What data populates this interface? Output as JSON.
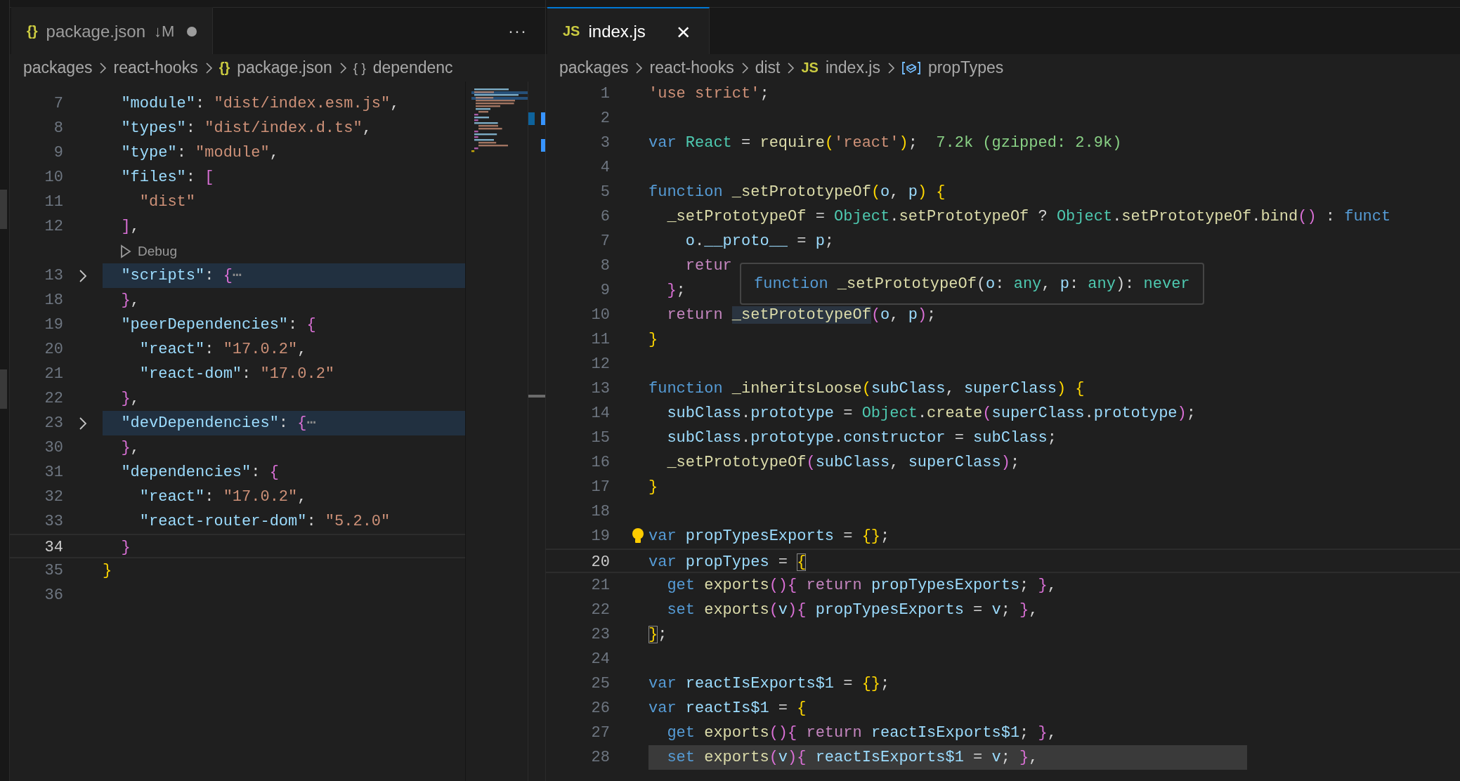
{
  "left_group": {
    "focused": false,
    "tabs": [
      {
        "icon": "{}",
        "label": "package.json",
        "badge": "↓M",
        "modified": true,
        "selected": true
      }
    ],
    "more": "···",
    "breadcrumbs": [
      {
        "kind": "text",
        "label": "packages"
      },
      {
        "kind": "text",
        "label": "react-hooks"
      },
      {
        "kind": "glyph",
        "icon": "{}",
        "label": "package.json"
      },
      {
        "kind": "glyph",
        "icon": "{ }",
        "label": "dependenc"
      }
    ],
    "lines": [
      {
        "kind": "code",
        "number": "7",
        "tokens": [
          {
            "kind": "key",
            "text": "  \"module\""
          },
          {
            "kind": "t",
            "text": ": "
          },
          {
            "kind": "str",
            "text": "\"dist/index.esm.js\""
          },
          {
            "kind": "t",
            "text": ","
          }
        ]
      },
      {
        "kind": "code",
        "number": "8",
        "tokens": [
          {
            "kind": "key",
            "text": "  \"types\""
          },
          {
            "kind": "t",
            "text": ": "
          },
          {
            "kind": "str",
            "text": "\"dist/index.d.ts\""
          },
          {
            "kind": "t",
            "text": ","
          }
        ]
      },
      {
        "kind": "code",
        "number": "9",
        "tokens": [
          {
            "kind": "key",
            "text": "  \"type\""
          },
          {
            "kind": "t",
            "text": ": "
          },
          {
            "kind": "str",
            "text": "\"module\""
          },
          {
            "kind": "t",
            "text": ","
          }
        ]
      },
      {
        "kind": "code",
        "number": "10",
        "tokens": [
          {
            "kind": "key",
            "text": "  \"files\""
          },
          {
            "kind": "t",
            "text": ": "
          },
          {
            "kind": "b2",
            "text": "["
          }
        ]
      },
      {
        "kind": "code",
        "number": "11",
        "tokens": [
          {
            "kind": "str",
            "text": "    \"dist\""
          }
        ]
      },
      {
        "kind": "code",
        "number": "12",
        "tokens": [
          {
            "kind": "b2",
            "text": "  ]"
          },
          {
            "kind": "t",
            "text": ","
          }
        ]
      },
      {
        "kind": "codelens",
        "label": "Debug"
      },
      {
        "kind": "folded",
        "number": "13",
        "tokens": [
          {
            "kind": "key",
            "text": "  \"scripts\""
          },
          {
            "kind": "t",
            "text": ": "
          },
          {
            "kind": "b2",
            "text": "{"
          },
          {
            "kind": "more",
            "text": "⋯"
          }
        ]
      },
      {
        "kind": "code",
        "number": "18",
        "tokens": [
          {
            "kind": "b2",
            "text": "  }"
          },
          {
            "kind": "t",
            "text": ","
          }
        ]
      },
      {
        "kind": "code",
        "number": "19",
        "tokens": [
          {
            "kind": "key",
            "text": "  \"peerDependencies\""
          },
          {
            "kind": "t",
            "text": ": "
          },
          {
            "kind": "b2",
            "text": "{"
          }
        ]
      },
      {
        "kind": "code",
        "number": "20",
        "tokens": [
          {
            "kind": "key",
            "text": "    \"react\""
          },
          {
            "kind": "t",
            "text": ": "
          },
          {
            "kind": "str",
            "text": "\"17.0.2\""
          },
          {
            "kind": "t",
            "text": ","
          }
        ]
      },
      {
        "kind": "code",
        "number": "21",
        "tokens": [
          {
            "kind": "key",
            "text": "    \"react-dom\""
          },
          {
            "kind": "t",
            "text": ": "
          },
          {
            "kind": "str",
            "text": "\"17.0.2\""
          }
        ]
      },
      {
        "kind": "code",
        "number": "22",
        "tokens": [
          {
            "kind": "b2",
            "text": "  }"
          },
          {
            "kind": "t",
            "text": ","
          }
        ]
      },
      {
        "kind": "folded",
        "number": "23",
        "tokens": [
          {
            "kind": "key",
            "text": "  \"devDependencies\""
          },
          {
            "kind": "t",
            "text": ": "
          },
          {
            "kind": "b2",
            "text": "{"
          },
          {
            "kind": "more",
            "text": "⋯"
          }
        ]
      },
      {
        "kind": "code",
        "number": "30",
        "tokens": [
          {
            "kind": "b2",
            "text": "  }"
          },
          {
            "kind": "t",
            "text": ","
          }
        ]
      },
      {
        "kind": "code",
        "number": "31",
        "tokens": [
          {
            "kind": "key",
            "text": "  \"dependencies\""
          },
          {
            "kind": "t",
            "text": ": "
          },
          {
            "kind": "b2",
            "text": "{"
          }
        ]
      },
      {
        "kind": "code",
        "number": "32",
        "tokens": [
          {
            "kind": "key",
            "text": "    \"react\""
          },
          {
            "kind": "t",
            "text": ": "
          },
          {
            "kind": "str",
            "text": "\"17.0.2\""
          },
          {
            "kind": "t",
            "text": ","
          }
        ]
      },
      {
        "kind": "code",
        "number": "33",
        "tokens": [
          {
            "kind": "key",
            "text": "    \"react-router-dom\""
          },
          {
            "kind": "t",
            "text": ": "
          },
          {
            "kind": "str",
            "text": "\"5.2.0\""
          }
        ]
      },
      {
        "kind": "current",
        "number": "34",
        "tokens": [
          {
            "kind": "b2",
            "text": "  }"
          }
        ]
      },
      {
        "kind": "code",
        "number": "35",
        "tokens": [
          {
            "kind": "b1",
            "text": "}"
          }
        ]
      },
      {
        "kind": "code",
        "number": "36"
      }
    ]
  },
  "right_group": {
    "focused": true,
    "tabs": [
      {
        "icon": "JS",
        "label": "index.js",
        "close": "×",
        "modified": false,
        "selected": true
      }
    ],
    "breadcrumbs": [
      {
        "kind": "text",
        "label": "packages"
      },
      {
        "kind": "text",
        "label": "react-hooks"
      },
      {
        "kind": "text",
        "label": "dist"
      },
      {
        "kind": "glyph",
        "icon": "JS",
        "label": "index.js"
      },
      {
        "kind": "symbol",
        "label": "propTypes"
      }
    ],
    "lines": [
      {
        "kind": "code",
        "number": "1",
        "tokens": [
          {
            "kind": "str",
            "text": "'use strict'"
          },
          {
            "kind": "t",
            "text": ";"
          }
        ]
      },
      {
        "kind": "code",
        "number": "2"
      },
      {
        "kind": "code",
        "number": "3",
        "tokens": [
          {
            "kind": "kw",
            "text": "var "
          },
          {
            "kind": "type",
            "text": "React"
          },
          {
            "kind": "t",
            "text": " = "
          },
          {
            "kind": "fn",
            "text": "require"
          },
          {
            "kind": "b1",
            "text": "("
          },
          {
            "kind": "str",
            "text": "'react'"
          },
          {
            "kind": "b1",
            "text": ")"
          },
          {
            "kind": "t",
            "text": ";"
          },
          {
            "kind": "hint",
            "text": "  7.2k (gzipped: 2.9k)"
          }
        ]
      },
      {
        "kind": "code",
        "number": "4"
      },
      {
        "kind": "code",
        "number": "5",
        "tokens": [
          {
            "kind": "kw",
            "text": "function "
          },
          {
            "kind": "fn",
            "text": "_setPrototypeOf"
          },
          {
            "kind": "b1",
            "text": "("
          },
          {
            "kind": "var",
            "text": "o"
          },
          {
            "kind": "t",
            "text": ", "
          },
          {
            "kind": "var",
            "text": "p"
          },
          {
            "kind": "b1",
            "text": ")"
          },
          {
            "kind": "b1",
            "text": " {"
          }
        ]
      },
      {
        "kind": "code",
        "number": "6",
        "tokens": [
          {
            "kind": "fn",
            "text": "  _setPrototypeOf"
          },
          {
            "kind": "t",
            "text": " = "
          },
          {
            "kind": "type",
            "text": "Object"
          },
          {
            "kind": "t",
            "text": "."
          },
          {
            "kind": "fn",
            "text": "setPrototypeOf"
          },
          {
            "kind": "t",
            "text": " ? "
          },
          {
            "kind": "type",
            "text": "Object"
          },
          {
            "kind": "t",
            "text": "."
          },
          {
            "kind": "fn",
            "text": "setPrototypeOf"
          },
          {
            "kind": "t",
            "text": "."
          },
          {
            "kind": "fn",
            "text": "bind"
          },
          {
            "kind": "b2",
            "text": "()"
          },
          {
            "kind": "t",
            "text": " : "
          },
          {
            "kind": "kw",
            "text": "funct"
          }
        ]
      },
      {
        "kind": "code",
        "number": "7",
        "tokens": [
          {
            "kind": "var",
            "text": "    o"
          },
          {
            "kind": "t",
            "text": "."
          },
          {
            "kind": "var",
            "text": "__proto__"
          },
          {
            "kind": "t",
            "text": " = "
          },
          {
            "kind": "var",
            "text": "p"
          },
          {
            "kind": "t",
            "text": ";"
          }
        ]
      },
      {
        "kind": "code",
        "number": "8",
        "tokens": [
          {
            "kind": "ctl",
            "text": "    retur"
          }
        ]
      },
      {
        "kind": "code",
        "number": "9",
        "tokens": [
          {
            "kind": "b2",
            "text": "  }"
          },
          {
            "kind": "t",
            "text": ";"
          }
        ]
      },
      {
        "kind": "code",
        "number": "10",
        "tokens": [
          {
            "kind": "ctl",
            "text": "  return "
          },
          {
            "kind": "fn-hover",
            "text": "_setPrototypeOf"
          },
          {
            "kind": "b2",
            "text": "("
          },
          {
            "kind": "var",
            "text": "o"
          },
          {
            "kind": "t",
            "text": ", "
          },
          {
            "kind": "var",
            "text": "p"
          },
          {
            "kind": "b2",
            "text": ")"
          },
          {
            "kind": "t",
            "text": ";"
          }
        ]
      },
      {
        "kind": "code",
        "number": "11",
        "tokens": [
          {
            "kind": "b1",
            "text": "}"
          }
        ]
      },
      {
        "kind": "code",
        "number": "12"
      },
      {
        "kind": "code",
        "number": "13",
        "tokens": [
          {
            "kind": "kw",
            "text": "function "
          },
          {
            "kind": "fn",
            "text": "_inheritsLoose"
          },
          {
            "kind": "b1",
            "text": "("
          },
          {
            "kind": "var",
            "text": "subClass"
          },
          {
            "kind": "t",
            "text": ", "
          },
          {
            "kind": "var",
            "text": "superClass"
          },
          {
            "kind": "b1",
            "text": ")"
          },
          {
            "kind": "b1",
            "text": " {"
          }
        ]
      },
      {
        "kind": "code",
        "number": "14",
        "tokens": [
          {
            "kind": "var",
            "text": "  subClass"
          },
          {
            "kind": "t",
            "text": "."
          },
          {
            "kind": "var",
            "text": "prototype"
          },
          {
            "kind": "t",
            "text": " = "
          },
          {
            "kind": "type",
            "text": "Object"
          },
          {
            "kind": "t",
            "text": "."
          },
          {
            "kind": "fn",
            "text": "create"
          },
          {
            "kind": "b2",
            "text": "("
          },
          {
            "kind": "var",
            "text": "superClass"
          },
          {
            "kind": "t",
            "text": "."
          },
          {
            "kind": "var",
            "text": "prototype"
          },
          {
            "kind": "b2",
            "text": ")"
          },
          {
            "kind": "t",
            "text": ";"
          }
        ]
      },
      {
        "kind": "code",
        "number": "15",
        "tokens": [
          {
            "kind": "var",
            "text": "  subClass"
          },
          {
            "kind": "t",
            "text": "."
          },
          {
            "kind": "var",
            "text": "prototype"
          },
          {
            "kind": "t",
            "text": "."
          },
          {
            "kind": "var",
            "text": "constructor"
          },
          {
            "kind": "t",
            "text": " = "
          },
          {
            "kind": "var",
            "text": "subClass"
          },
          {
            "kind": "t",
            "text": ";"
          }
        ]
      },
      {
        "kind": "code",
        "number": "16",
        "tokens": [
          {
            "kind": "fn",
            "text": "  _setPrototypeOf"
          },
          {
            "kind": "b2",
            "text": "("
          },
          {
            "kind": "var",
            "text": "subClass"
          },
          {
            "kind": "t",
            "text": ", "
          },
          {
            "kind": "var",
            "text": "superClass"
          },
          {
            "kind": "b2",
            "text": ")"
          },
          {
            "kind": "t",
            "text": ";"
          }
        ]
      },
      {
        "kind": "code",
        "number": "17",
        "tokens": [
          {
            "kind": "b1",
            "text": "}"
          }
        ]
      },
      {
        "kind": "code",
        "number": "18"
      },
      {
        "kind": "lightbulb",
        "number": "19",
        "tokens": [
          {
            "kind": "kw",
            "text": "var "
          },
          {
            "kind": "var",
            "text": "propTypesExports"
          },
          {
            "kind": "t",
            "text": " = "
          },
          {
            "kind": "b1",
            "text": "{}"
          },
          {
            "kind": "t",
            "text": ";"
          }
        ]
      },
      {
        "kind": "current",
        "number": "20",
        "tokens": [
          {
            "kind": "kw",
            "text": "var "
          },
          {
            "kind": "var",
            "text": "propTypes"
          },
          {
            "kind": "t",
            "text": " = "
          },
          {
            "kind": "b1-match",
            "text": "{"
          }
        ]
      },
      {
        "kind": "code",
        "number": "21",
        "tokens": [
          {
            "kind": "kw",
            "text": "  get "
          },
          {
            "kind": "fn",
            "text": "exports"
          },
          {
            "kind": "b2",
            "text": "()"
          },
          {
            "kind": "b2",
            "text": "{"
          },
          {
            "kind": "ctl",
            "text": " return "
          },
          {
            "kind": "var",
            "text": "propTypesExports"
          },
          {
            "kind": "t",
            "text": "; "
          },
          {
            "kind": "b2",
            "text": "}"
          },
          {
            "kind": "t",
            "text": ","
          }
        ]
      },
      {
        "kind": "code",
        "number": "22",
        "tokens": [
          {
            "kind": "kw",
            "text": "  set "
          },
          {
            "kind": "fn",
            "text": "exports"
          },
          {
            "kind": "b2",
            "text": "("
          },
          {
            "kind": "var",
            "text": "v"
          },
          {
            "kind": "b2",
            "text": ")"
          },
          {
            "kind": "b2",
            "text": "{"
          },
          {
            "kind": "var",
            "text": " propTypesExports"
          },
          {
            "kind": "t",
            "text": " = "
          },
          {
            "kind": "var",
            "text": "v"
          },
          {
            "kind": "t",
            "text": "; "
          },
          {
            "kind": "b2",
            "text": "}"
          },
          {
            "kind": "t",
            "text": ","
          }
        ]
      },
      {
        "kind": "code",
        "number": "23",
        "tokens": [
          {
            "kind": "b1-match",
            "text": "}"
          },
          {
            "kind": "t",
            "text": ";"
          }
        ]
      },
      {
        "kind": "code",
        "number": "24"
      },
      {
        "kind": "code",
        "number": "25",
        "tokens": [
          {
            "kind": "kw",
            "text": "var "
          },
          {
            "kind": "var",
            "text": "reactIsExports$1"
          },
          {
            "kind": "t",
            "text": " = "
          },
          {
            "kind": "b1",
            "text": "{}"
          },
          {
            "kind": "t",
            "text": ";"
          }
        ]
      },
      {
        "kind": "code",
        "number": "26",
        "tokens": [
          {
            "kind": "kw",
            "text": "var "
          },
          {
            "kind": "var",
            "text": "reactIs$1"
          },
          {
            "kind": "t",
            "text": " = "
          },
          {
            "kind": "b1",
            "text": "{"
          }
        ]
      },
      {
        "kind": "code",
        "number": "27",
        "tokens": [
          {
            "kind": "kw",
            "text": "  get "
          },
          {
            "kind": "fn",
            "text": "exports"
          },
          {
            "kind": "b2",
            "text": "()"
          },
          {
            "kind": "b2",
            "text": "{"
          },
          {
            "kind": "ctl",
            "text": " return "
          },
          {
            "kind": "var",
            "text": "reactIsExports$1"
          },
          {
            "kind": "t",
            "text": "; "
          },
          {
            "kind": "b2",
            "text": "}"
          },
          {
            "kind": "t",
            "text": ","
          }
        ]
      },
      {
        "kind": "selection",
        "number": "28",
        "tokens": [
          {
            "kind": "kw",
            "text": "  set "
          },
          {
            "kind": "fn",
            "text": "exports"
          },
          {
            "kind": "b2",
            "text": "("
          },
          {
            "kind": "var",
            "text": "v"
          },
          {
            "kind": "b2",
            "text": ")"
          },
          {
            "kind": "b2",
            "text": "{"
          },
          {
            "kind": "var",
            "text": " reactIsExports$1"
          },
          {
            "kind": "t",
            "text": " = "
          },
          {
            "kind": "var",
            "text": "v"
          },
          {
            "kind": "t",
            "text": "; "
          },
          {
            "kind": "b2",
            "text": "}"
          },
          {
            "kind": "t",
            "text": ","
          }
        ]
      }
    ],
    "hover": {
      "tokens": [
        {
          "kind": "kw",
          "text": "function "
        },
        {
          "kind": "fn",
          "text": "_setPrototypeOf"
        },
        {
          "kind": "t",
          "text": "("
        },
        {
          "kind": "var",
          "text": "o"
        },
        {
          "kind": "t",
          "text": ": "
        },
        {
          "kind": "type",
          "text": "any"
        },
        {
          "kind": "t",
          "text": ", "
        },
        {
          "kind": "var",
          "text": "p"
        },
        {
          "kind": "t",
          "text": ": "
        },
        {
          "kind": "type",
          "text": "any"
        },
        {
          "kind": "t",
          "text": "): "
        },
        {
          "kind": "type",
          "text": "never"
        }
      ]
    }
  }
}
